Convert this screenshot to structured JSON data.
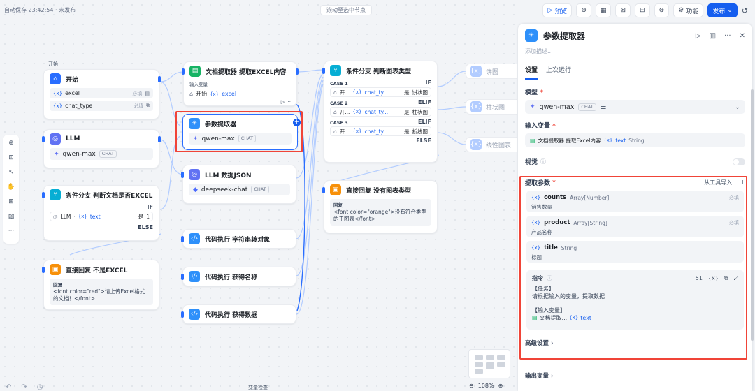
{
  "topbar": {
    "status": "自动保存 23:42:54 · 未发布",
    "scroll_selected": "滚动至选中节点",
    "preview": "预览",
    "features": "功能",
    "publish": "发布"
  },
  "nodes": {
    "start": {
      "group_label": "开始",
      "title": "开始",
      "vars": [
        {
          "name": "excel",
          "required": "必填"
        },
        {
          "name": "chat_type",
          "required": "必填"
        }
      ]
    },
    "llm1": {
      "title": "LLM",
      "model": "qwen-max",
      "tag": "CHAT"
    },
    "ifelse1": {
      "title": "条件分支 判断文档是否EXCEL",
      "if": "IF",
      "else": "ELSE",
      "cond_src": "LLM",
      "cond_var": "text",
      "cond_op": "是",
      "cond_val": "1"
    },
    "answer1": {
      "title": "直接回复 不是EXCEL",
      "label": "回复",
      "text": "<font color=\"red\">请上传Excel格式的文档！</font>"
    },
    "docext": {
      "title": "文档提取器 提取EXCEL内容",
      "label": "输入变量",
      "src": "开始",
      "var": "excel"
    },
    "param": {
      "title": "参数提取器",
      "model": "qwen-max",
      "tag": "CHAT"
    },
    "llm2": {
      "title": "LLM 数据JSON",
      "model": "deepseek-chat",
      "tag": "CHAT"
    },
    "code1": {
      "title": "代码执行 字符串转对象"
    },
    "code2": {
      "title": "代码执行 获得名称"
    },
    "code3": {
      "title": "代码执行 获得数据"
    },
    "ifelse2": {
      "title": "条件分支 判断图表类型",
      "else": "ELSE",
      "cases": [
        {
          "label": "CASE 1",
          "kind": "IF",
          "src": "开...",
          "var": "chat_ty...",
          "op": "是",
          "val": "饼状图"
        },
        {
          "label": "CASE 2",
          "kind": "ELIF",
          "src": "开...",
          "var": "chat_ty...",
          "op": "是",
          "val": "柱状图"
        },
        {
          "label": "CASE 3",
          "kind": "ELIF",
          "src": "开...",
          "var": "chat_ty...",
          "op": "是",
          "val": "折线图"
        }
      ]
    },
    "answer2": {
      "title": "直接回复 没有图表类型",
      "label": "回复",
      "text": "<font color=\"orange\">没有符合类型的于图表</font>"
    },
    "charts": [
      "饼图",
      "柱状图",
      "线性图表"
    ]
  },
  "canvas_bottom": {
    "var_check": "变量检查",
    "zoom": "108%"
  },
  "panel": {
    "title": "参数提取器",
    "desc_placeholder": "添加描述...",
    "tabs": [
      "设置",
      "上次运行"
    ],
    "model_label": "模型",
    "model_name": "qwen-max",
    "model_tag": "CHAT",
    "input_label": "输入变量",
    "input_src": "文档提取器 提取Excel内容",
    "input_var": "text",
    "input_type": "String",
    "vision_label": "视觉",
    "params_label": "提取参数",
    "import_from_tool": "从工具导入",
    "params": [
      {
        "name": "counts",
        "type": "Array[Number]",
        "desc": "销售数量",
        "required": "必填"
      },
      {
        "name": "product",
        "type": "Array[String]",
        "desc": "产品名称",
        "required": "必填"
      },
      {
        "name": "title",
        "type": "String",
        "desc": "标题",
        "required": ""
      }
    ],
    "instruction": {
      "label": "指令",
      "count": "51",
      "line1": "【任务】",
      "line2": "请根据输入的变量，提取数据",
      "line3": "【输入变量】",
      "ref_src": "文档提取...",
      "ref_var": "text"
    },
    "advanced_label": "高级设置",
    "output_label": "输出变量"
  },
  "colors": {
    "accent": "#155eef",
    "highlight": "#f04438"
  }
}
